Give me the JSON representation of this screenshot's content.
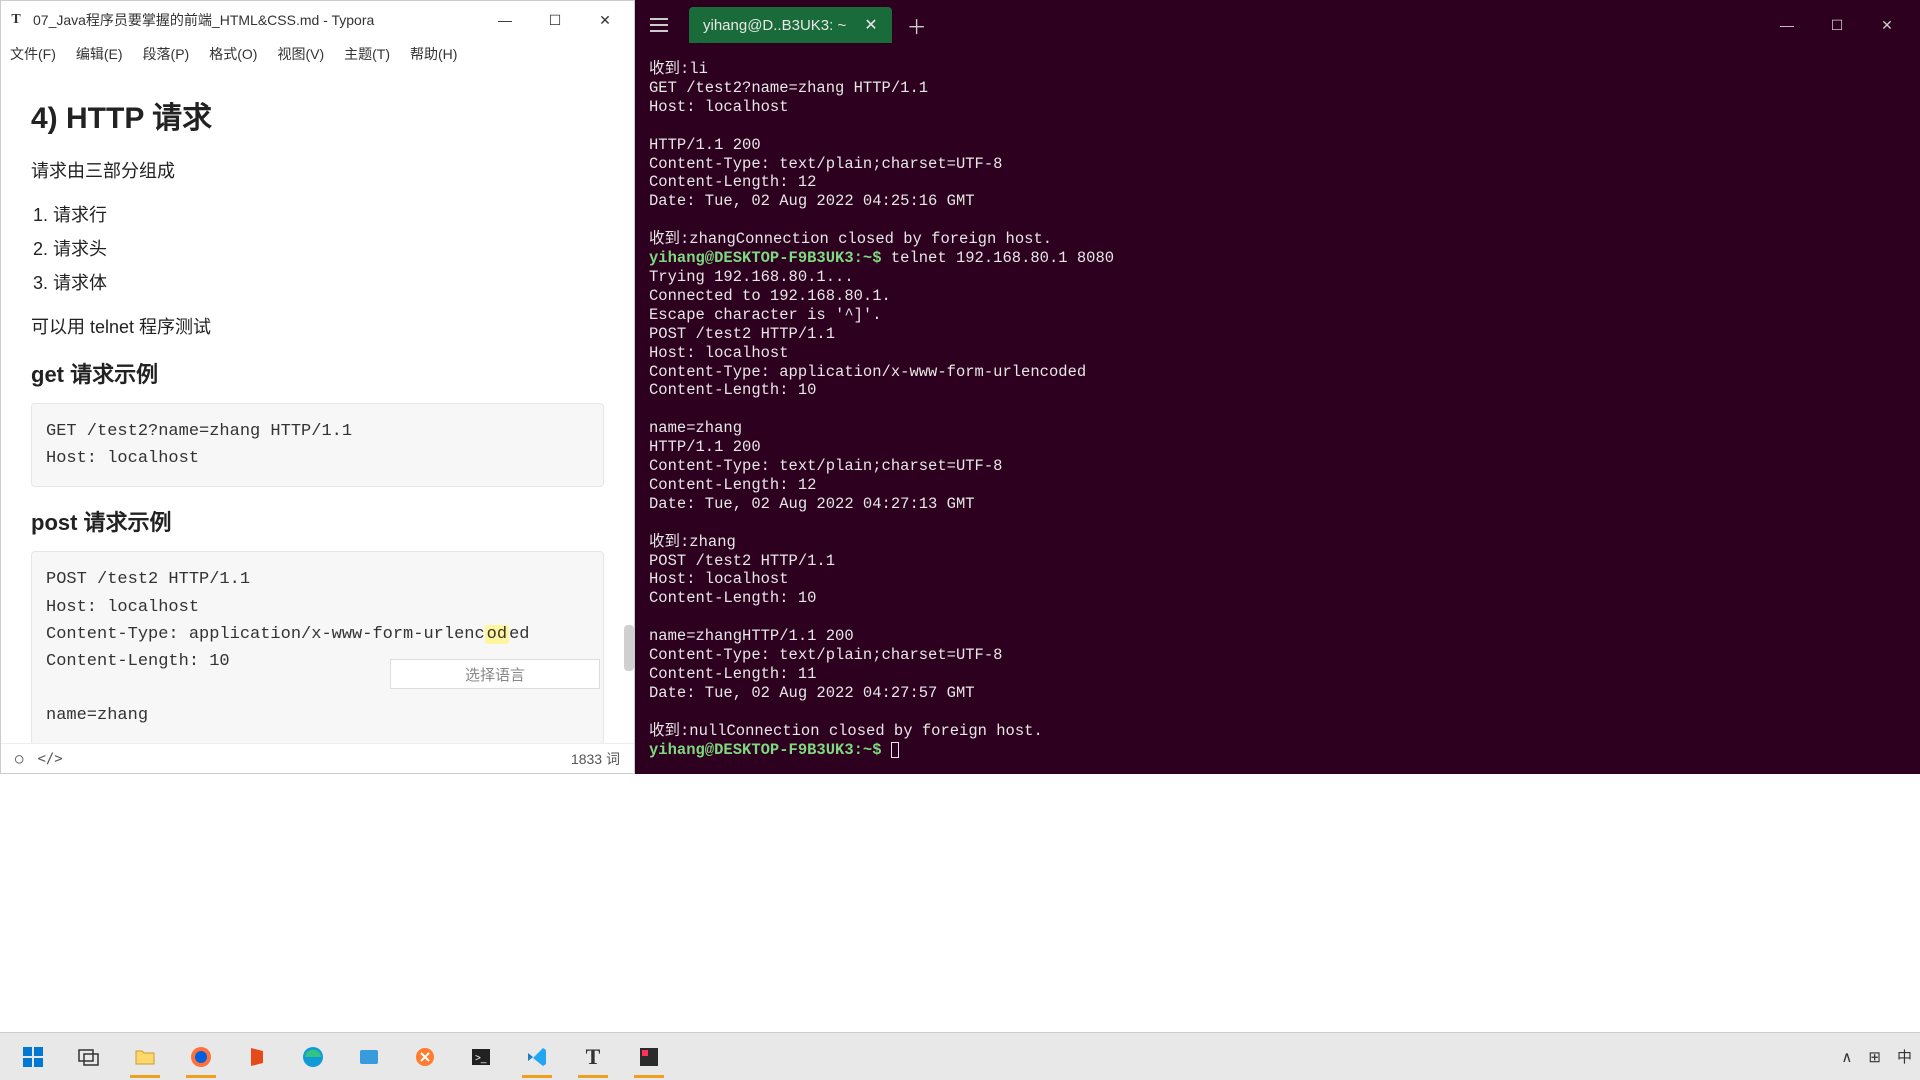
{
  "typora": {
    "title_icon": "T",
    "title": "07_Java程序员要掌握的前端_HTML&CSS.md - Typora",
    "menu": [
      "文件(F)",
      "编辑(E)",
      "段落(P)",
      "格式(O)",
      "视图(V)",
      "主题(T)",
      "帮助(H)"
    ],
    "content": {
      "h2": "4) HTTP 请求",
      "desc": "请求由三部分组成",
      "ol": [
        "请求行",
        "请求头",
        "请求体"
      ],
      "telnet": "可以用 telnet 程序测试",
      "h3_get": "get 请求示例",
      "code_get": "GET /test2?name=zhang HTTP/1.1\nHost: localhost",
      "h3_post": "post 请求示例",
      "code_post_a": "POST /test2 HTTP/1.1\nHost: localhost\nContent-Type: application/x-www-form-urlenc",
      "code_post_hl": "od",
      "code_post_b": "ed\nContent-Length: 10\n\nname=zhang",
      "lang_placeholder": "选择语言"
    },
    "status": {
      "circle": "○",
      "code_icon": "</>",
      "wordcount": "1833 词"
    }
  },
  "terminal": {
    "tab": "yihang@D..B3UK3: ~",
    "lines": [
      {
        "t": "plain",
        "v": "收到:li"
      },
      {
        "t": "plain",
        "v": "GET /test2?name=zhang HTTP/1.1"
      },
      {
        "t": "plain",
        "v": "Host: localhost"
      },
      {
        "t": "blank"
      },
      {
        "t": "plain",
        "v": "HTTP/1.1 200"
      },
      {
        "t": "plain",
        "v": "Content-Type: text/plain;charset=UTF-8"
      },
      {
        "t": "plain",
        "v": "Content-Length: 12"
      },
      {
        "t": "plain",
        "v": "Date: Tue, 02 Aug 2022 04:25:16 GMT"
      },
      {
        "t": "blank"
      },
      {
        "t": "plain",
        "v": "收到:zhangConnection closed by foreign host."
      },
      {
        "t": "prompt",
        "p": "yihang@DESKTOP-F9B3UK3:~$ ",
        "c": "telnet 192.168.80.1 8080"
      },
      {
        "t": "plain",
        "v": "Trying 192.168.80.1..."
      },
      {
        "t": "plain",
        "v": "Connected to 192.168.80.1."
      },
      {
        "t": "plain",
        "v": "Escape character is '^]'."
      },
      {
        "t": "plain",
        "v": "POST /test2 HTTP/1.1"
      },
      {
        "t": "plain",
        "v": "Host: localhost"
      },
      {
        "t": "plain",
        "v": "Content-Type: application/x-www-form-urlencoded"
      },
      {
        "t": "plain",
        "v": "Content-Length: 10"
      },
      {
        "t": "blank"
      },
      {
        "t": "plain",
        "v": "name=zhang"
      },
      {
        "t": "plain",
        "v": "HTTP/1.1 200"
      },
      {
        "t": "plain",
        "v": "Content-Type: text/plain;charset=UTF-8"
      },
      {
        "t": "plain",
        "v": "Content-Length: 12"
      },
      {
        "t": "plain",
        "v": "Date: Tue, 02 Aug 2022 04:27:13 GMT"
      },
      {
        "t": "blank"
      },
      {
        "t": "plain",
        "v": "收到:zhang"
      },
      {
        "t": "plain",
        "v": "POST /test2 HTTP/1.1"
      },
      {
        "t": "plain",
        "v": "Host: localhost"
      },
      {
        "t": "plain",
        "v": "Content-Length: 10"
      },
      {
        "t": "blank"
      },
      {
        "t": "plain",
        "v": "name=zhangHTTP/1.1 200"
      },
      {
        "t": "plain",
        "v": "Content-Type: text/plain;charset=UTF-8"
      },
      {
        "t": "plain",
        "v": "Content-Length: 11"
      },
      {
        "t": "plain",
        "v": "Date: Tue, 02 Aug 2022 04:27:57 GMT"
      },
      {
        "t": "blank"
      },
      {
        "t": "plain",
        "v": "收到:nullConnection closed by foreign host."
      },
      {
        "t": "prompt",
        "p": "yihang@DESKTOP-F9B3UK3:~$ ",
        "c": ""
      }
    ]
  },
  "taskbar": {
    "tray": {
      "chevron": "∧",
      "grid": "⊞",
      "ime": "中"
    }
  }
}
